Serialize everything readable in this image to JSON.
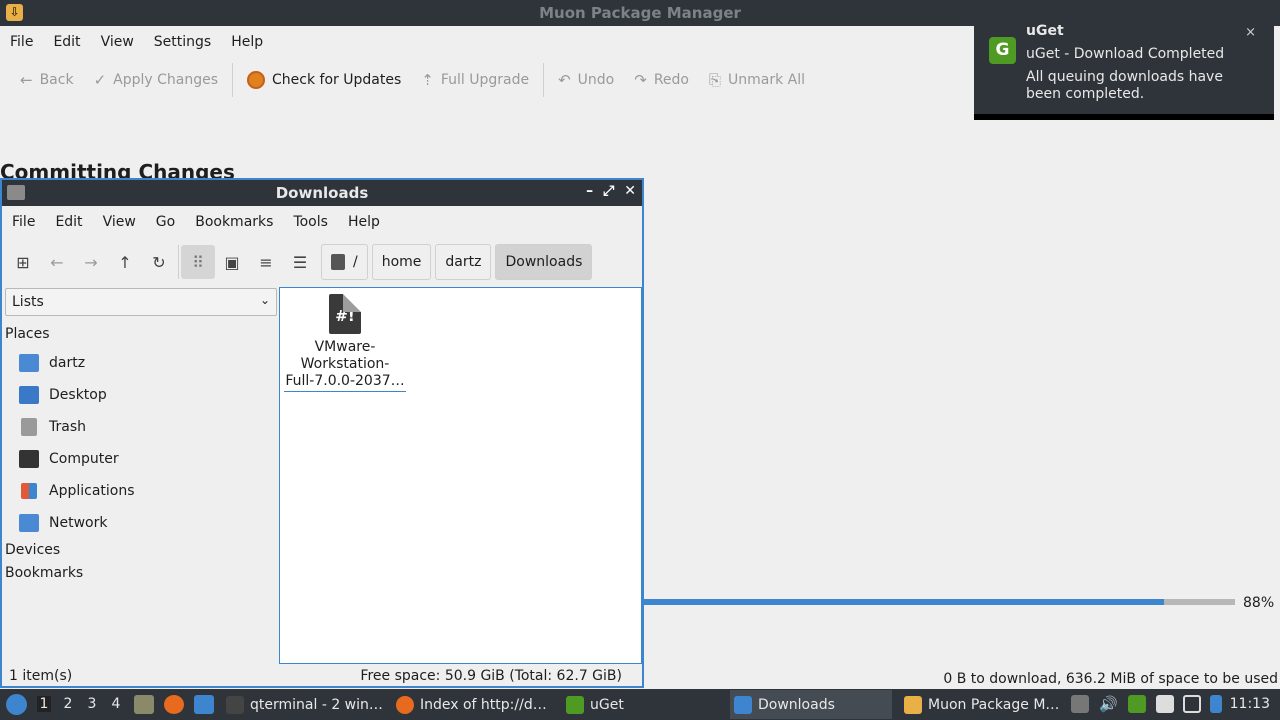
{
  "muon": {
    "title": "Muon Package Manager",
    "menu": [
      "File",
      "Edit",
      "View",
      "Settings",
      "Help"
    ],
    "toolbar": {
      "back": "Back",
      "apply": "Apply Changes",
      "check_updates": "Check for Updates",
      "full_upgrade": "Full Upgrade",
      "undo": "Undo",
      "redo": "Redo",
      "unmark_all": "Unmark All"
    },
    "heading": "Committing Changes",
    "progress_percent": 88,
    "progress_label": "88%",
    "download_status": "0 B to download, 636.2 MiB of space to be used"
  },
  "notification": {
    "app": "uGet",
    "summary": "uGet - Download Completed",
    "body": "All queuing downloads have been completed.",
    "close": "×"
  },
  "downloads": {
    "title": "Downloads",
    "menu": [
      "File",
      "Edit",
      "View",
      "Go",
      "Bookmarks",
      "Tools",
      "Help"
    ],
    "breadcrumb": [
      "/",
      "home",
      "dartz",
      "Downloads"
    ],
    "side_select": "Lists",
    "places_label": "Places",
    "places": [
      "dartz",
      "Desktop",
      "Trash",
      "Computer",
      "Applications",
      "Network"
    ],
    "devices_label": "Devices",
    "bookmarks_label": "Bookmarks",
    "file": {
      "name": "VMware-Workstation-Full-7.0.0-2037…",
      "line1": "VMware-",
      "line2": "Workstation-",
      "line3": "Full-7.0.0-2037…",
      "icon_text": "#!"
    },
    "status_left": "1 item(s)",
    "status_right": "Free space: 50.9 GiB (Total: 62.7 GiB)"
  },
  "taskbar": {
    "workspaces": [
      "1",
      "2",
      "3",
      "4"
    ],
    "tasks": [
      "qterminal - 2 win…",
      "Index of http://d…",
      "uGet",
      "Downloads",
      "Muon Package M…"
    ],
    "clock": "11:13"
  },
  "colors": {
    "accent": "#3d86cf",
    "titlebar": "#2f343a",
    "notification_bg": "#2f343a"
  }
}
